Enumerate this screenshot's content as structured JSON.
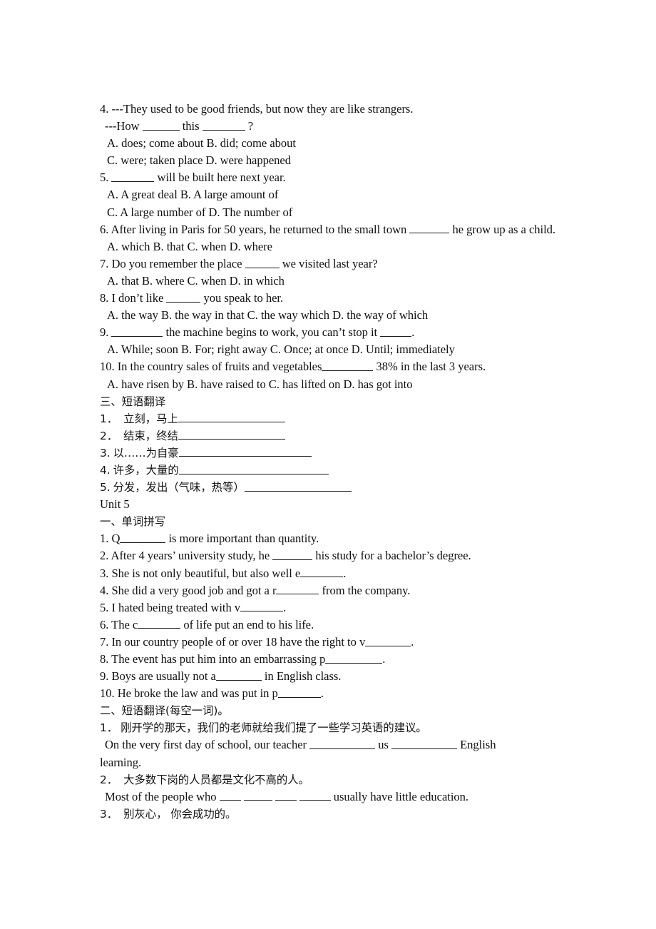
{
  "document": {
    "type": "worksheet",
    "lines": [
      {
        "id": "q4_stem",
        "text": "4. ---They used to be good friends, but now they are like strangers."
      },
      {
        "id": "q4_stem2a",
        "text": "---How "
      },
      {
        "id": "q4_stem2b",
        "text": " this "
      },
      {
        "id": "q4_stem2c",
        "text": " ?"
      },
      {
        "id": "q4_optAB",
        "text": "A. does; come about B. did; come about"
      },
      {
        "id": "q4_optCD",
        "text": "C. were; taken place D. were happened"
      },
      {
        "id": "q5_num",
        "text": "5. "
      },
      {
        "id": "q5_rest",
        "text": " will be built here next year."
      },
      {
        "id": "q5_optAB",
        "text": "A. A great deal B. A large amount of"
      },
      {
        "id": "q5_optCD",
        "text": "C. A large number of D. The number of"
      },
      {
        "id": "q6_a",
        "text": "6. After living in Paris for 50 years, he returned to the small town "
      },
      {
        "id": "q6_b",
        "text": " he grow up as a child."
      },
      {
        "id": "q6_opts",
        "text": "A. which B. that C. when D. where"
      },
      {
        "id": "q7_a",
        "text": "7. Do you remember the place "
      },
      {
        "id": "q7_b",
        "text": " we visited last year?"
      },
      {
        "id": "q7_opts",
        "text": "A. that B. where C. when D. in which"
      },
      {
        "id": "q8_a",
        "text": "8. I don’t like "
      },
      {
        "id": "q8_b",
        "text": " you speak to her."
      },
      {
        "id": "q8_opts",
        "text": "A. the way B. the way in that C. the way which D. the way of which"
      },
      {
        "id": "q9_a",
        "text": "9. "
      },
      {
        "id": "q9_b",
        "text": " the machine begins to work, you can’t stop it "
      },
      {
        "id": "q9_c",
        "text": "."
      },
      {
        "id": "q9_opts",
        "text": "A. While; soon B. For; right away C. Once; at once D. Until; immediately"
      },
      {
        "id": "q10_a",
        "text": "10. In the country sales of fruits and vegetables"
      },
      {
        "id": "q10_b",
        "text": " 38% in the last 3 years."
      },
      {
        "id": "q10_opts",
        "text": "A. have risen by B. have raised to C. has lifted on D. has got into"
      }
    ],
    "section_three_heading": "三、短语翻译",
    "phrase_items": [
      {
        "num": "1．",
        "text": "立刻，马上"
      },
      {
        "num": "2．",
        "text": "结束，终结"
      },
      {
        "num": "3.",
        "text": "以……为自豪"
      },
      {
        "num": "4.",
        "text": "许多，大量的"
      },
      {
        "num": "5.",
        "text": "分发，发出（气味，热等）"
      }
    ],
    "unit_heading": "Unit 5",
    "section_one_heading": "一、单词拼写",
    "spelling_items": [
      {
        "pre": "1. Q",
        "post": " is more important than quantity."
      },
      {
        "pre": "2. After 4 years’ university study, he ",
        "post": " his study for a bachelor’s degree."
      },
      {
        "pre": "3. She is not only beautiful, but also well e",
        "post": "."
      },
      {
        "pre": "4. She did a very good job and got a r",
        "post": " from the company."
      },
      {
        "pre": "5. I hated being treated with v",
        "post": "."
      },
      {
        "pre": "6. The c",
        "post": " of life put an end to his life."
      },
      {
        "pre": "7. In our country people of or over 18 have the right to v",
        "post": "."
      },
      {
        "pre": "8. The event has put him into an embarrassing p",
        "post": "."
      },
      {
        "pre": "9. Boys are usually not a",
        "post": " in English class."
      },
      {
        "pre": "10. He broke the law and was put in p",
        "post": "."
      }
    ],
    "section_two_heading": "二、短语翻译(每空一词)。",
    "translation_items": [
      {
        "num": "1．",
        "chinese": "刚开学的那天，我们的老师就给我们提了一些学习英语的建议。",
        "english_a": "On the very first day of school, our teacher ",
        "english_b": " us ",
        "english_c": " English",
        "english_d": "learning."
      },
      {
        "num": "2．",
        "chinese": "大多数下岗的人员都是文化不高的人。",
        "english_a": "Most of the people who ",
        "english_b": " usually have little education."
      },
      {
        "num": "3．",
        "chinese": "别灰心， 你会成功的。"
      }
    ]
  }
}
